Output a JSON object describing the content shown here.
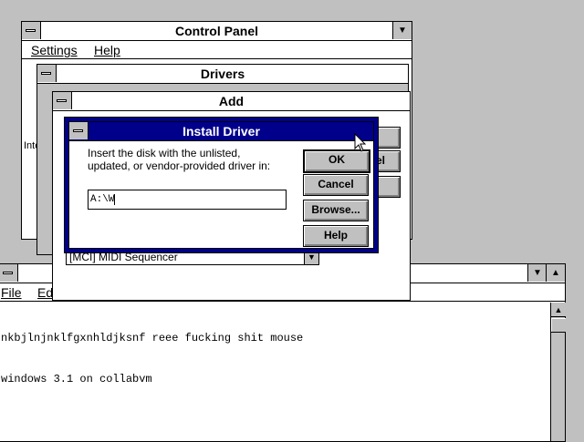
{
  "control_panel": {
    "title": "Control Panel",
    "menu": [
      "Settings",
      "Help"
    ],
    "partial_text": "Inte"
  },
  "drivers": {
    "title": "Drivers"
  },
  "add": {
    "title": "Add",
    "selected_driver": "[MCI] MIDI Sequencer",
    "partial_cancel": "el"
  },
  "install": {
    "title": "Install Driver",
    "prompt_line1": "Insert the disk with the unlisted,",
    "prompt_line2": "updated, or vendor-provided driver in:",
    "path_value": "A:\\W",
    "ok_label": "OK",
    "cancel_label": "Cancel",
    "browse_label": "Browse...",
    "help_label": "Help"
  },
  "notepad": {
    "menu_file": "File",
    "menu_edit_partial": "Ed",
    "lines": [
      "nkbjlnjnklfgxnhldjksnf reee fucking shit mouse",
      "windows 3.1 on collabvm"
    ]
  }
}
